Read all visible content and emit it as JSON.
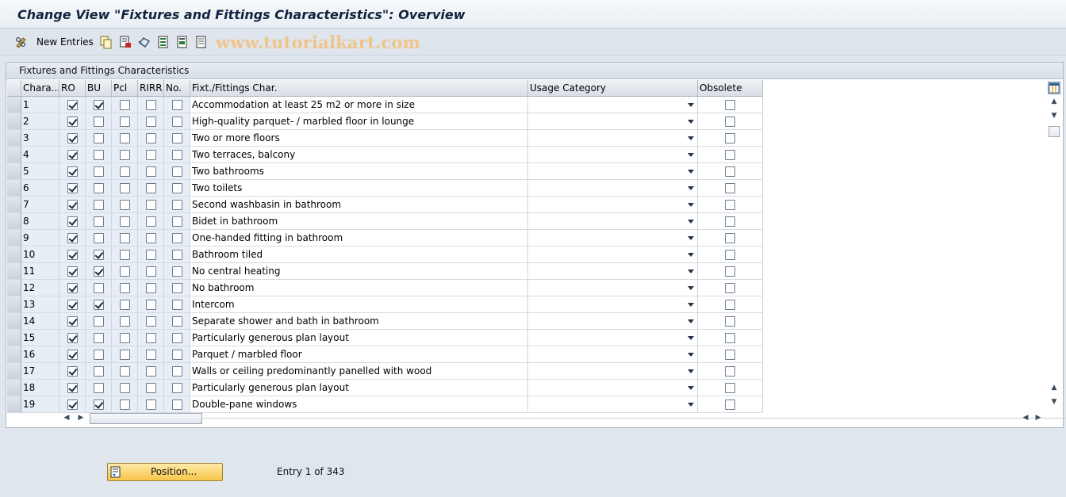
{
  "window": {
    "title": "Change View \"Fixtures and Fittings Characteristics\": Overview"
  },
  "toolbar": {
    "new_entries_label": "New Entries",
    "icons": [
      "edit-glasses-icon",
      "copy-icon",
      "delete-icon",
      "undo-icon",
      "select-all-icon",
      "select-block-icon",
      "deselect-all-icon"
    ],
    "watermark": "www.tutorialkart.com"
  },
  "table": {
    "frame_title": "Fixtures and Fittings Characteristics",
    "headers": {
      "chara": "Chara...",
      "ro": "RO",
      "bu": "BU",
      "pcl": "Pcl",
      "rirr": "RIRR",
      "no": "No.",
      "fixt": "Fixt./Fittings Char.",
      "usage": "Usage Category",
      "obsolete": "Obsolete"
    },
    "rows": [
      {
        "id": "1",
        "ro": true,
        "bu": true,
        "pcl": false,
        "rirr": false,
        "no": false,
        "text": "Accommodation at least 25 m2 or more in size",
        "usage": "",
        "obsolete": false
      },
      {
        "id": "2",
        "ro": true,
        "bu": false,
        "pcl": false,
        "rirr": false,
        "no": false,
        "text": "High-quality parquet- / marbled floor in lounge",
        "usage": "",
        "obsolete": false
      },
      {
        "id": "3",
        "ro": true,
        "bu": false,
        "pcl": false,
        "rirr": false,
        "no": false,
        "text": "Two or more floors",
        "usage": "",
        "obsolete": false
      },
      {
        "id": "4",
        "ro": true,
        "bu": false,
        "pcl": false,
        "rirr": false,
        "no": false,
        "text": "Two terraces, balcony",
        "usage": "",
        "obsolete": false
      },
      {
        "id": "5",
        "ro": true,
        "bu": false,
        "pcl": false,
        "rirr": false,
        "no": false,
        "text": "Two bathrooms",
        "usage": "",
        "obsolete": false
      },
      {
        "id": "6",
        "ro": true,
        "bu": false,
        "pcl": false,
        "rirr": false,
        "no": false,
        "text": "Two toilets",
        "usage": "",
        "obsolete": false
      },
      {
        "id": "7",
        "ro": true,
        "bu": false,
        "pcl": false,
        "rirr": false,
        "no": false,
        "text": "Second washbasin in bathroom",
        "usage": "",
        "obsolete": false
      },
      {
        "id": "8",
        "ro": true,
        "bu": false,
        "pcl": false,
        "rirr": false,
        "no": false,
        "text": "Bidet in bathroom",
        "usage": "",
        "obsolete": false
      },
      {
        "id": "9",
        "ro": true,
        "bu": false,
        "pcl": false,
        "rirr": false,
        "no": false,
        "text": "One-handed fitting in bathroom",
        "usage": "",
        "obsolete": false
      },
      {
        "id": "10",
        "ro": true,
        "bu": true,
        "pcl": false,
        "rirr": false,
        "no": false,
        "text": "Bathroom tiled",
        "usage": "",
        "obsolete": false
      },
      {
        "id": "11",
        "ro": true,
        "bu": true,
        "pcl": false,
        "rirr": false,
        "no": false,
        "text": "No central heating",
        "usage": "",
        "obsolete": false
      },
      {
        "id": "12",
        "ro": true,
        "bu": false,
        "pcl": false,
        "rirr": false,
        "no": false,
        "text": "No bathroom",
        "usage": "",
        "obsolete": false
      },
      {
        "id": "13",
        "ro": true,
        "bu": true,
        "pcl": false,
        "rirr": false,
        "no": false,
        "text": "Intercom",
        "usage": "",
        "obsolete": false
      },
      {
        "id": "14",
        "ro": true,
        "bu": false,
        "pcl": false,
        "rirr": false,
        "no": false,
        "text": "Separate shower and bath in bathroom",
        "usage": "",
        "obsolete": false
      },
      {
        "id": "15",
        "ro": true,
        "bu": false,
        "pcl": false,
        "rirr": false,
        "no": false,
        "text": "Particularly generous plan layout",
        "usage": "",
        "obsolete": false
      },
      {
        "id": "16",
        "ro": true,
        "bu": false,
        "pcl": false,
        "rirr": false,
        "no": false,
        "text": "Parquet / marbled floor",
        "usage": "",
        "obsolete": false
      },
      {
        "id": "17",
        "ro": true,
        "bu": false,
        "pcl": false,
        "rirr": false,
        "no": false,
        "text": "Walls or ceiling predominantly panelled with wood",
        "usage": "",
        "obsolete": false
      },
      {
        "id": "18",
        "ro": true,
        "bu": false,
        "pcl": false,
        "rirr": false,
        "no": false,
        "text": "Particularly generous plan layout",
        "usage": "",
        "obsolete": false
      },
      {
        "id": "19",
        "ro": true,
        "bu": true,
        "pcl": false,
        "rirr": false,
        "no": false,
        "text": "Double-pane windows",
        "usage": "",
        "obsolete": false
      }
    ]
  },
  "footer": {
    "position_label": "Position...",
    "entry_text": "Entry 1 of 343"
  },
  "colors": {
    "key_column_bg": "#e7eef6",
    "position_button": "#f8c54a",
    "watermark": "#f0c48a"
  }
}
